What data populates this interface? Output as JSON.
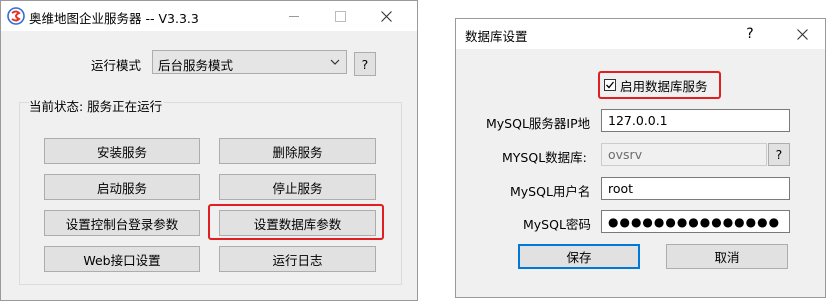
{
  "left": {
    "title": "奥维地图企业服务器 -- V3.3.3",
    "run_mode_label": "运行模式",
    "run_mode_value": "后台服务模式",
    "help_label": "?",
    "status": "当前状态: 服务正在运行",
    "buttons": {
      "install": "安装服务",
      "delete": "删除服务",
      "start": "启动服务",
      "stop": "停止服务",
      "console_login": "设置控制台登录参数",
      "db_params": "设置数据库参数",
      "web_api": "Web接口设置",
      "run_log": "运行日志"
    }
  },
  "right": {
    "title": "数据库设置",
    "help_label": "?",
    "enable_db": "启用数据库服务",
    "enable_db_checked": true,
    "labels": {
      "ip": "MySQL服务器IP地",
      "db": "MYSQL数据库:",
      "user": "MySQL用户名",
      "password": "MySQL密码"
    },
    "values": {
      "ip": "127.0.0.1",
      "db": "ovsrv",
      "user": "root",
      "password": "●●●●●●●●●●●●●●●"
    },
    "db_help": "?",
    "save": "保存",
    "cancel": "取消"
  }
}
